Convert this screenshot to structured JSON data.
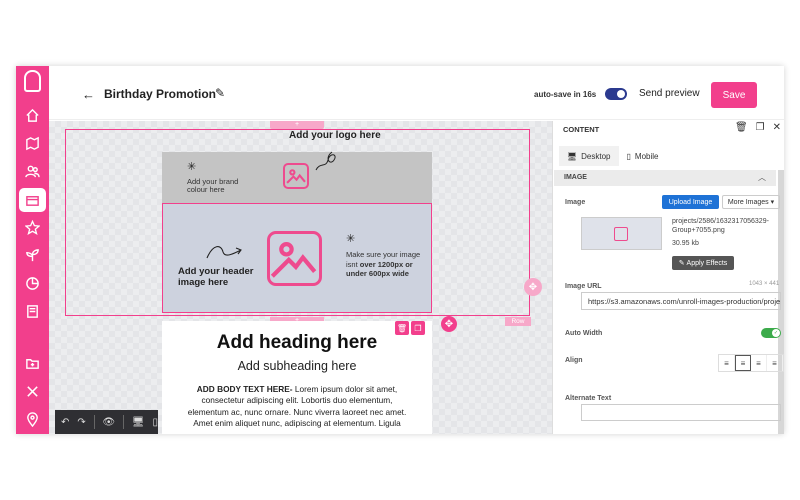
{
  "header": {
    "back_icon": "arrow-left-icon",
    "title": "Birthday Promotion",
    "autosave_text": "auto-save in 16s",
    "send_preview": "Send preview",
    "save": "Save"
  },
  "sidebar": {
    "icons": [
      "home-icon",
      "map-icon",
      "users-icon",
      "campaign-icon",
      "star-icon",
      "plant-icon",
      "chart-icon",
      "book-icon",
      "folder-plus-icon",
      "tools-icon",
      "location-icon"
    ],
    "accent": "#f23f8c"
  },
  "canvas": {
    "plus": "+",
    "logo_text": "Add your logo here",
    "brand_text": "Add your brand colour here",
    "header_text": "Add your header image here",
    "header_note_1": "Make sure your image isnt ",
    "header_note_bold": "over 1200px or under 600px wide",
    "row_label": "Row",
    "heading": "Add heading here",
    "subheading": "Add subheading here",
    "body_bold": "ADD BODY TEXT HERE-",
    "body_text": " Lorem ipsum dolor sit amet, consectetur adipiscing elit. Lobortis duo elementum, elementum ac, nunc ornare. Nunc viverra laoreet nec amet. Amet enim aliquet nunc, adipiscing at elementum. Ligula"
  },
  "panel": {
    "title": "CONTENT",
    "tabs": [
      "Desktop",
      "Mobile"
    ],
    "section": "IMAGE",
    "image_label": "Image",
    "upload": "Upload Image",
    "more_images": "More Images",
    "file_path": "projects/2586/1632317056329-Group+7055.png",
    "file_size": "30.95 kb",
    "apply_effects": "Apply Effects",
    "image_url_label": "Image URL",
    "dimensions": "1043 × 441",
    "image_url": "https://s3.amazonaws.com/unroll-images-production/projects/2586",
    "auto_width_label": "Auto Width",
    "align_label": "Align",
    "alt_text_label": "Alternate Text"
  }
}
